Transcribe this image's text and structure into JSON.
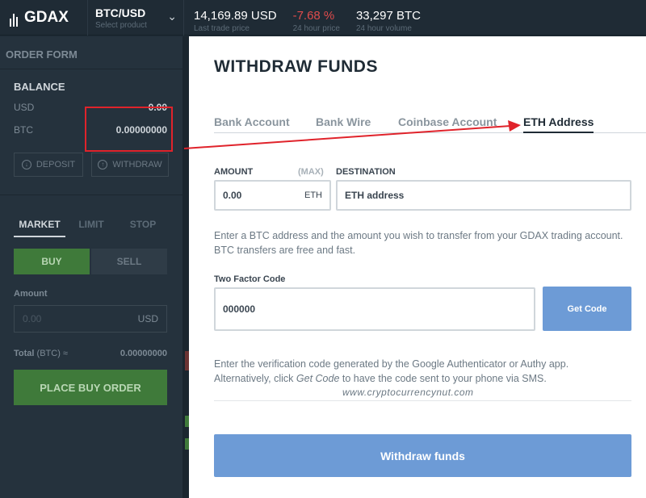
{
  "topbar": {
    "logo": "GDAX",
    "product_name": "BTC/USD",
    "product_sub": "Select product",
    "last_price": "14,169.89 USD",
    "last_price_label": "Last trade price",
    "change": "-7.68 %",
    "change_label": "24 hour price",
    "volume": "33,297 BTC",
    "volume_label": "24 hour volume"
  },
  "sidebar": {
    "header": "ORDER FORM",
    "balance_title": "BALANCE",
    "balances": [
      {
        "currency": "USD",
        "amount": "0.00"
      },
      {
        "currency": "BTC",
        "amount": "0.00000000"
      }
    ],
    "deposit_label": "DEPOSIT",
    "withdraw_label": "WITHDRAW",
    "order_tabs": [
      "MARKET",
      "LIMIT",
      "STOP"
    ],
    "buy_label": "BUY",
    "sell_label": "SELL",
    "amount_label": "Amount",
    "amount_placeholder": "0.00",
    "amount_unit": "USD",
    "total_label": "Total",
    "total_unit": "(BTC) ≈",
    "total_value": "0.00000000",
    "place_order_label": "PLACE BUY ORDER"
  },
  "modal": {
    "title": "WITHDRAW FUNDS",
    "tabs": [
      "Bank Account",
      "Bank Wire",
      "Coinbase Account",
      "ETH Address"
    ],
    "active_tab": "ETH Address",
    "amount_label": "AMOUNT",
    "max_label": "(MAX)",
    "amount_value": "0.00",
    "amount_unit": "ETH",
    "destination_label": "DESTINATION",
    "destination_placeholder": "ETH address",
    "help_text_1": "Enter a BTC address and the amount you wish to transfer from your GDAX trading account. BTC transfers are free and fast.",
    "two_factor_label": "Two Factor Code",
    "two_factor_value": "000000",
    "get_code_label": "Get Code",
    "help_text_2_a": "Enter the verification code generated by the Google Authenticator or Authy app. Alternatively, click ",
    "help_text_2_link": "Get Code",
    "help_text_2_b": " to have the code sent to your phone via SMS.",
    "watermark": "www.cryptocurrencynut.com",
    "withdraw_button_label": "Withdraw funds"
  },
  "colors": {
    "annotation_red": "#e0232b",
    "button_blue": "#6d9bd6",
    "buy_green": "#3f7a3a",
    "negative_red": "#e04c4c"
  }
}
